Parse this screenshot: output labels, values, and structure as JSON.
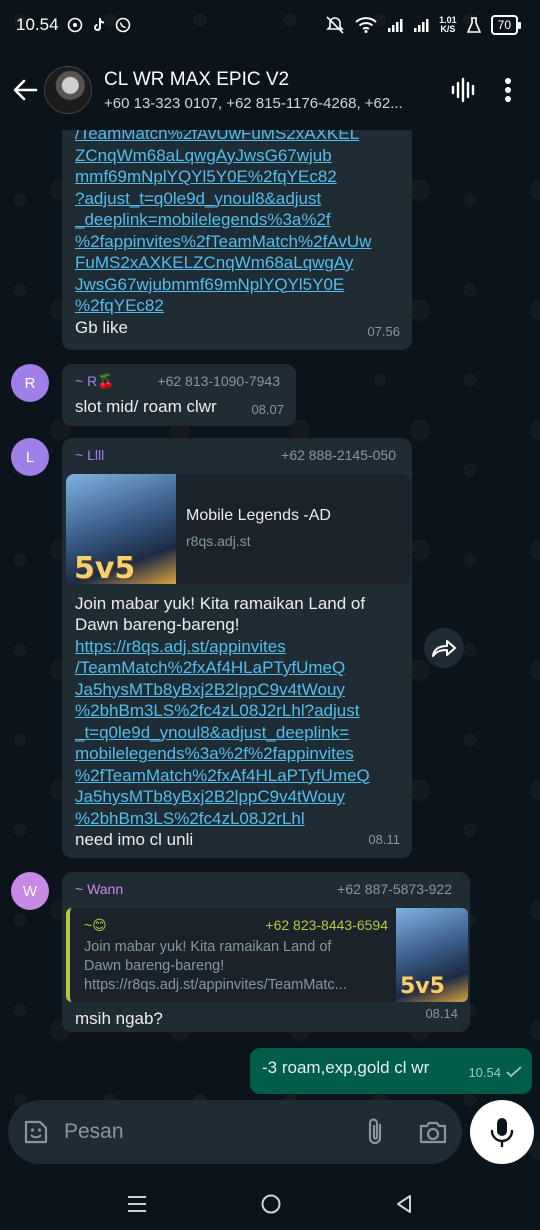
{
  "status_bar": {
    "time": "10.54",
    "net_speed": "1.01",
    "net_unit": "K/S",
    "battery": "70"
  },
  "header": {
    "title": "CL WR MAX EPIC V2",
    "subtitle": "+60 13-323 0107, +62 815-1176-4268, +62..."
  },
  "messages": {
    "m1": {
      "link_lines": [
        "/TeamMatch%2fAvUwFuMS2xAXKEL",
        "ZCnqWm68aLqwgAyJwsG67wjub",
        "mmf69mNplYQYl5Y0E%2fqYEc82",
        "?adjust_t=q0le9d_ynoul8&adjust",
        "_deeplink=mobilelegends%3a%2f",
        "%2fappinvites%2fTeamMatch%2fAvUw",
        "FuMS2xAXKELZCnqWm68aLqwgAy",
        "JwsG67wjubmmf69mNplYQYl5Y0E",
        "%2fqYEc82"
      ],
      "text": "Gb like",
      "time": "07.56"
    },
    "m2": {
      "avatar": "R",
      "sender": "~ R🍒",
      "phone": "+62 813-1090-7943",
      "text": "slot mid/ roam clwr",
      "time": "08.07"
    },
    "m3": {
      "avatar": "L",
      "sender": "~ Llll",
      "phone": "+62 888-2145-050",
      "preview_title": "Mobile Legends -AD",
      "preview_domain": "r8qs.adj.st",
      "thumb_text": "5v5",
      "text_line1": "Join mabar yuk! Kita ramaikan Land of",
      "text_line2": "Dawn bareng-bareng!",
      "link_lines": [
        "https://r8qs.adj.st/appinvites",
        "/TeamMatch%2fxAf4HLaPTyfUmeQ",
        "Ja5hysMTb8yBxj2B2lppC9v4tWouy",
        "%2bhBm3LS%2fc4zL08J2rLhl?adjust",
        "_t=q0le9d_ynoul8&adjust_deeplink=",
        "mobilelegends%3a%2f%2fappinvites",
        "%2fTeamMatch%2fxAf4HLaPTyfUmeQ",
        "Ja5hysMTb8yBxj2B2lppC9v4tWouy",
        "%2bhBm3LS%2fc4zL08J2rLhl"
      ],
      "footer": "need imo cl unli",
      "time": "08.11"
    },
    "m4": {
      "avatar": "W",
      "sender": "~ Wann",
      "phone": "+62 887-5873-922",
      "quote_sender": "~😊",
      "quote_phone": "+62 823-8443-6594",
      "quote_line1": "Join mabar yuk! Kita ramaikan Land of",
      "quote_line2": "Dawn bareng-bareng!",
      "quote_line3": "https://r8qs.adj.st/appinvites/TeamMatc...",
      "thumb_text": "5v5",
      "text": "msih ngab?",
      "time": "08.14"
    },
    "m5": {
      "text": "-3 roam,exp,gold cl wr",
      "time": "10.54"
    }
  },
  "input": {
    "placeholder": "Pesan"
  },
  "colors": {
    "background": "#0b141a",
    "incoming_bubble": "#202c33",
    "outgoing_bubble": "#005c4b",
    "link": "#53bdeb",
    "avatar_r": "#a07fe8",
    "avatar_l": "#a07fe8",
    "avatar_w": "#c889e6"
  }
}
